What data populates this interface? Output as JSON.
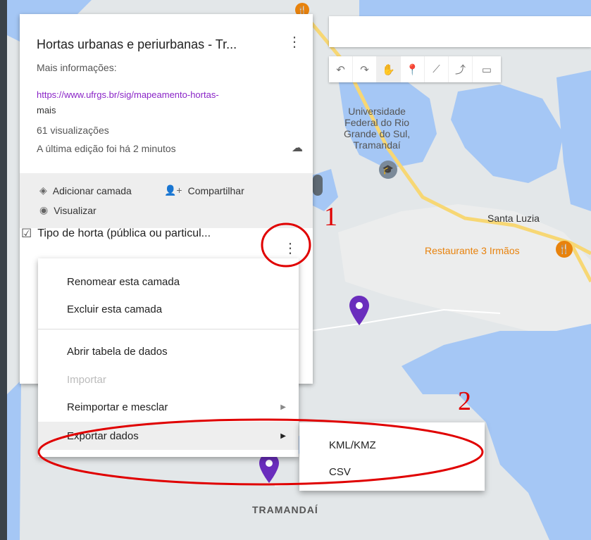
{
  "panel": {
    "title": "Hortas urbanas e periurbanas - Tr...",
    "more_info": "Mais informações:",
    "link": "https://www.ufrgs.br/sig/mapeamento-hortas-",
    "link_rest": "mais",
    "views": "61 visualizações",
    "last_edit": "A última edição foi há 2 minutos",
    "actions": {
      "add_layer": "Adicionar camada",
      "share": "Compartilhar",
      "preview": "Visualizar"
    },
    "layer_name": "Tipo de horta (pública ou particul..."
  },
  "menu": {
    "items": [
      {
        "label": "Renomear esta camada"
      },
      {
        "label": "Excluir esta camada"
      },
      {
        "label": "Abrir tabela de dados"
      },
      {
        "label": "Importar"
      },
      {
        "label": "Reimportar e mesclar"
      },
      {
        "label": "Exportar dados"
      }
    ]
  },
  "submenu": {
    "items": [
      {
        "label": "KML/KMZ"
      },
      {
        "label": "CSV"
      }
    ]
  },
  "map": {
    "labels": {
      "university": [
        "Universidade",
        "Federal do Rio",
        "Grande do Sul,",
        "Tramandaí"
      ],
      "santa_luzia": "Santa Luzia",
      "restaurant": "Restaurante 3 Irmãos",
      "tramandai": "TRAMANDAÍ"
    }
  },
  "annotations": {
    "one": "1",
    "two": "2"
  },
  "colors": {
    "water": "#a5c7f5",
    "road": "#f7d774",
    "link": "#8a25c7",
    "marker": "#6a2dbd",
    "annotation": "#e00000",
    "restaurant": "#e8820c"
  }
}
